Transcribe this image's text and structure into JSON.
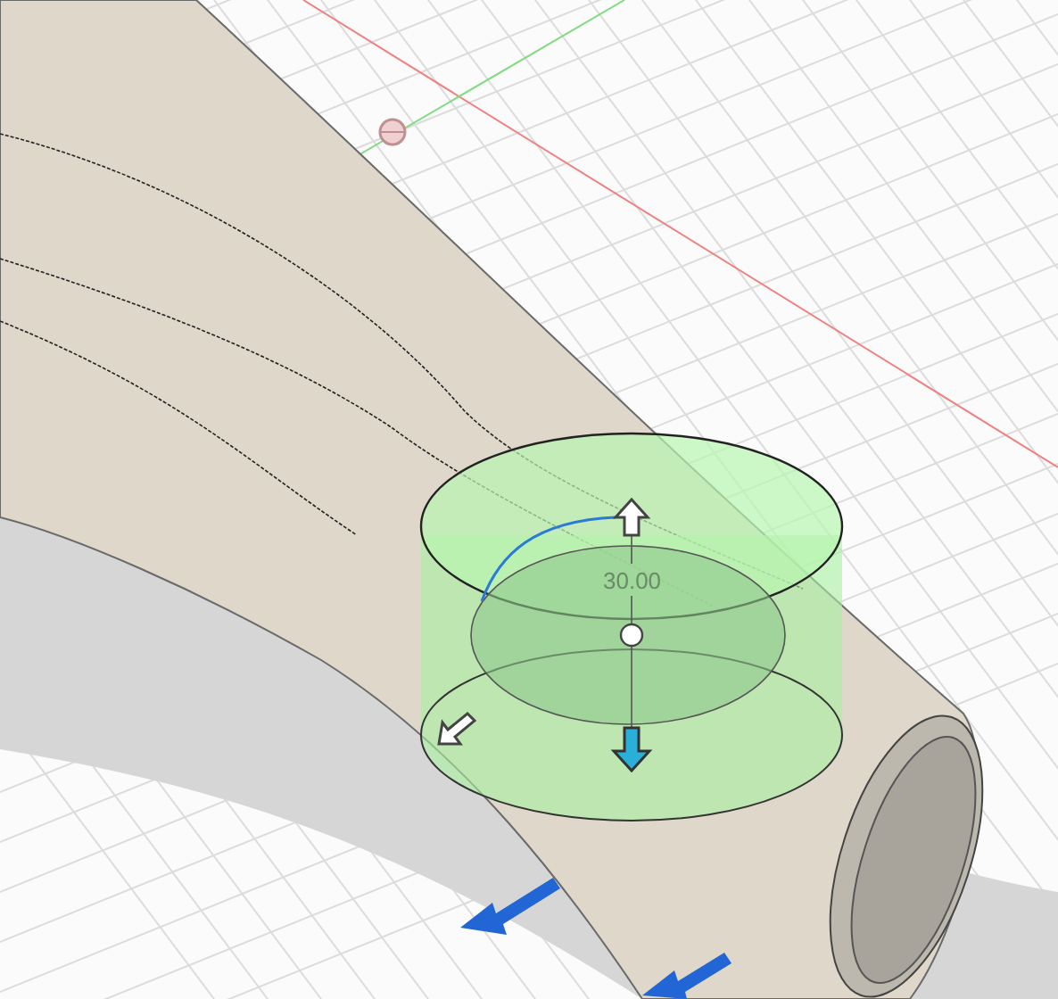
{
  "viewport": {
    "dimension_label": "30.00"
  }
}
